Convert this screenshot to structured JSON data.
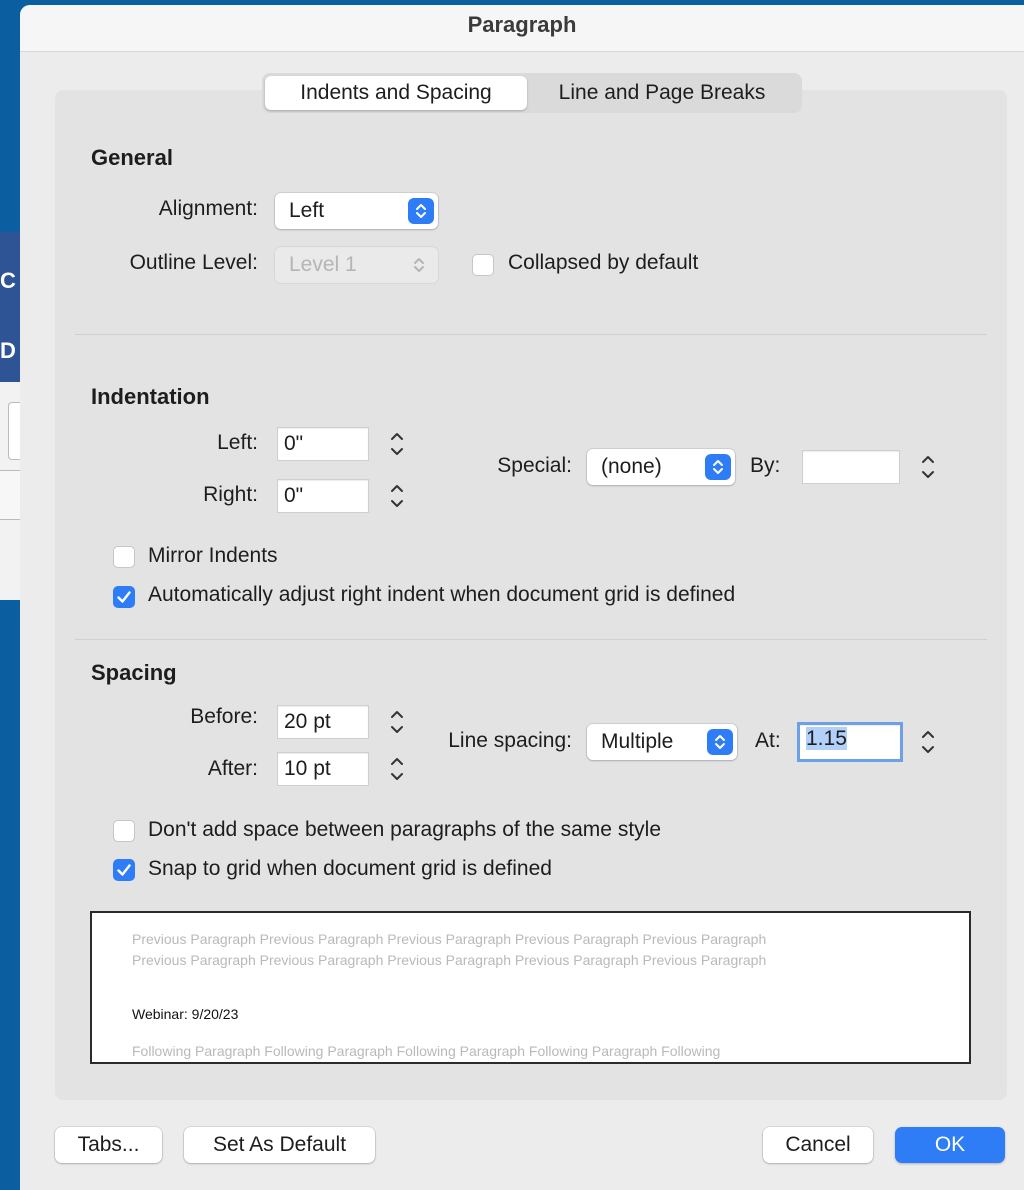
{
  "background": {
    "app_fragments": [
      "C",
      "D"
    ]
  },
  "dialog": {
    "title": "Paragraph",
    "tabs": [
      {
        "label": "Indents and Spacing",
        "active": true
      },
      {
        "label": "Line and Page Breaks",
        "active": false
      }
    ]
  },
  "general": {
    "heading": "General",
    "alignment_label": "Alignment:",
    "alignment_value": "Left",
    "outline_level_label": "Outline Level:",
    "outline_level_value": "Level 1",
    "outline_level_enabled": false,
    "collapsed_label": "Collapsed by default",
    "collapsed_checked": false
  },
  "indentation": {
    "heading": "Indentation",
    "left_label": "Left:",
    "left_value": "0\"",
    "right_label": "Right:",
    "right_value": "0\"",
    "special_label": "Special:",
    "special_value": "(none)",
    "by_label": "By:",
    "by_value": "",
    "mirror_label": "Mirror Indents",
    "mirror_checked": false,
    "auto_adjust_label": "Automatically adjust right indent when document grid is defined",
    "auto_adjust_checked": true
  },
  "spacing": {
    "heading": "Spacing",
    "before_label": "Before:",
    "before_value": "20 pt",
    "after_label": "After:",
    "after_value": "10 pt",
    "line_spacing_label": "Line spacing:",
    "line_spacing_value": "Multiple",
    "at_label": "At:",
    "at_value": "1.15",
    "dont_add_label": "Don't add space between paragraphs of the same style",
    "dont_add_checked": false,
    "snap_label": "Snap to grid when document grid is defined",
    "snap_checked": true
  },
  "preview": {
    "previous_line_1": "Previous Paragraph Previous Paragraph Previous Paragraph Previous Paragraph Previous Paragraph",
    "previous_line_2": "Previous Paragraph Previous Paragraph Previous Paragraph Previous Paragraph Previous Paragraph",
    "current": "Webinar: 9/20/23",
    "following": "Following Paragraph Following Paragraph Following Paragraph Following Paragraph Following"
  },
  "buttons": {
    "tabs": "Tabs...",
    "set_default": "Set As Default",
    "cancel": "Cancel",
    "ok": "OK"
  },
  "colors": {
    "accent": "#2f7df6",
    "desktop": "#0b5fa0",
    "dialog_bg": "#ececec"
  }
}
